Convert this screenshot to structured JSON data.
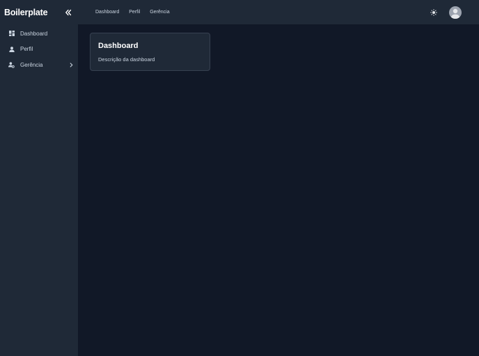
{
  "sidebar": {
    "brand": "Boilerplate",
    "collapse_icon": "chevrons-left-icon",
    "items": [
      {
        "label": "Dashboard",
        "icon": "dashboard-grid-icon"
      },
      {
        "label": "Perfil",
        "icon": "user-icon"
      },
      {
        "label": "Gerência",
        "icon": "user-cog-icon",
        "has_children": true
      }
    ]
  },
  "topbar": {
    "links": [
      "Dashboard",
      "Perfil",
      "Gerência"
    ],
    "theme_icon": "sun-icon",
    "avatar_icon": "user-avatar-icon"
  },
  "main": {
    "card": {
      "title": "Dashboard",
      "description": "Descrição da dashboard"
    }
  },
  "colors": {
    "sidebar_bg": "#1f2937",
    "main_bg": "#111827",
    "card_border": "#374151",
    "text": "#cbd5e1"
  }
}
